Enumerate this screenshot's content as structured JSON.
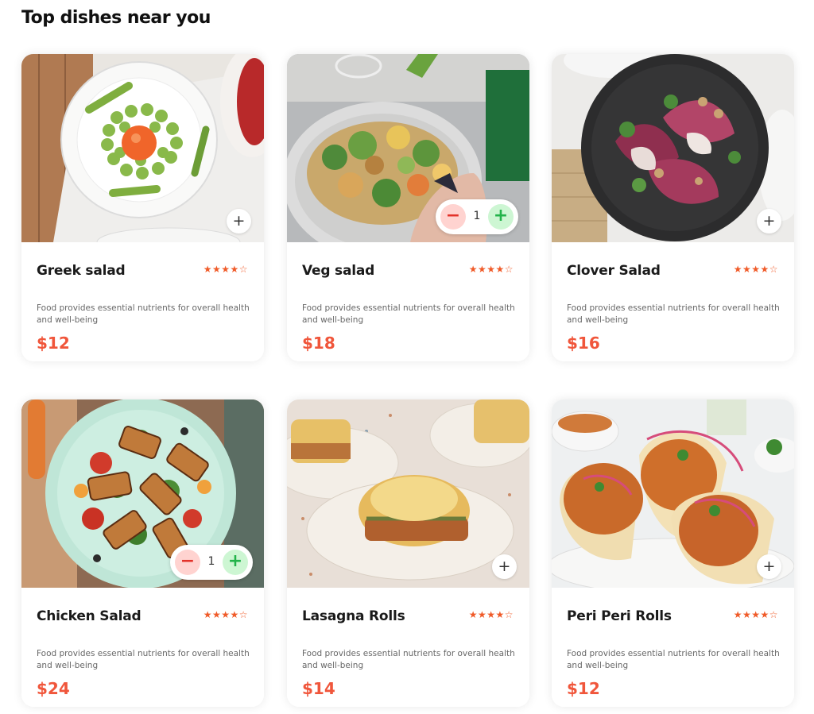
{
  "page": {
    "title": "Top dishes near you"
  },
  "colors": {
    "accent": "#f0563b",
    "star": "#f05a28",
    "minus_bg": "#ffd3d0",
    "plus_bg": "#cdf6d3"
  },
  "dishes": [
    {
      "name": "Greek salad",
      "rating_stars": "★★★★☆",
      "rating": 4,
      "description": "Food provides essential nutrients for overall health and well-being",
      "price": "$12",
      "add_icon": "+",
      "image": "bowl of asparagus and egg yolk salad"
    },
    {
      "name": "Veg salad",
      "rating_stars": "★★★★☆",
      "rating": 4,
      "description": "Food provides essential nutrients for overall health and well-being",
      "price": "$18",
      "counter": {
        "minus": "−",
        "qty": "1",
        "plus": "+"
      },
      "image": "veggie salad with fork"
    },
    {
      "name": "Clover Salad",
      "rating_stars": "★★★★☆",
      "rating": 4,
      "description": "Food provides essential nutrients for overall health and well-being",
      "price": "$16",
      "add_icon": "+",
      "image": "radicchio salad on dark plate"
    },
    {
      "name": "Chicken Salad",
      "rating_stars": "★★★★☆",
      "rating": 4,
      "description": "Food provides essential nutrients for overall health and well-being",
      "price": "$24",
      "counter": {
        "minus": "−",
        "qty": "1",
        "plus": "+"
      },
      "image": "grilled halloumi salad on mint plate"
    },
    {
      "name": "Lasagna Rolls",
      "rating_stars": "★★★★☆",
      "rating": 4,
      "description": "Food provides essential nutrients for overall health and well-being",
      "price": "$14",
      "add_icon": "+",
      "image": "lasagna rolls on white plates"
    },
    {
      "name": "Peri Peri Rolls",
      "rating_stars": "★★★★☆",
      "rating": 4,
      "description": "Food provides essential nutrients for overall health and well-being",
      "price": "$12",
      "add_icon": "+",
      "image": "wraps with spicy filling"
    }
  ]
}
